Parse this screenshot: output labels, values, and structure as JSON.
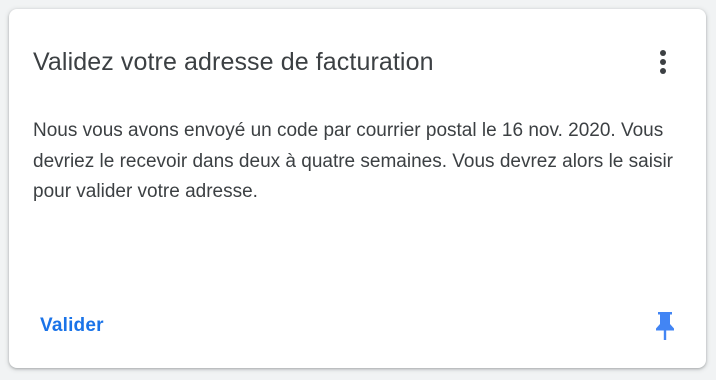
{
  "card": {
    "title": "Validez votre adresse de facturation",
    "body": "Nous vous avons envoyé un code par courrier postal le 16 nov. 2020. Vous devriez le recevoir dans deux à quatre semaines. Vous devrez alors le saisir pour valider votre adresse.",
    "action_label": "Valider",
    "menu_icon": "more-vert-icon",
    "pin_icon": "pin-icon"
  },
  "colors": {
    "text": "#3c4043",
    "accent": "#1a73e8",
    "pin": "#4285f4",
    "background": "#f1f3f4"
  }
}
